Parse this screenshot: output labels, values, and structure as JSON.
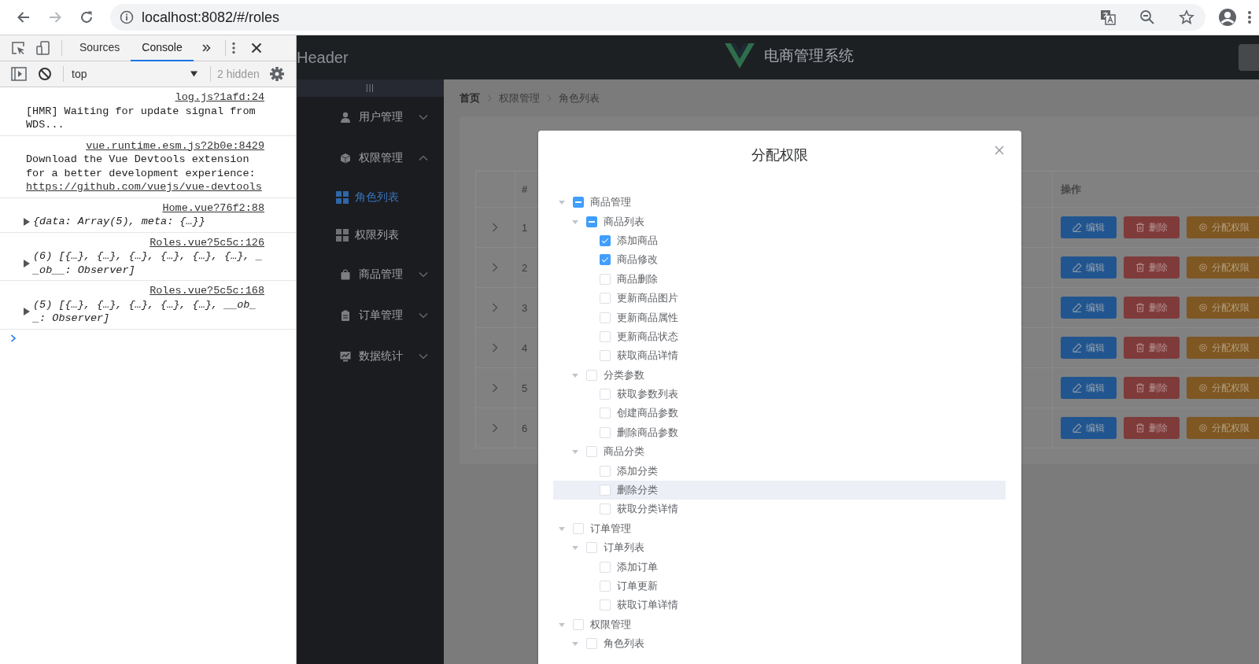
{
  "browser": {
    "url": "localhost:8082/#/roles"
  },
  "devtools": {
    "tabs": [
      {
        "label": "Sources",
        "selected": false
      },
      {
        "label": "Console",
        "selected": true
      }
    ],
    "context": "top",
    "hidden_count": "2 hidden",
    "messages": [
      {
        "kind": "text",
        "text": "[HMR] Waiting for update signal from WDS...",
        "source": "log.js?1afd:24"
      },
      {
        "kind": "text",
        "text": "Download the Vue Devtools extension for a better development experience:",
        "source": "vue.runtime.esm.js?2b0e:8429",
        "link": "https://github.com/vuejs/vue-devtools"
      },
      {
        "kind": "object",
        "text": "{data: Array(5), meta: {…}}",
        "source": "Home.vue?76f2:88",
        "expanded": false
      },
      {
        "kind": "object",
        "text": "(6) [{…}, {…}, {…}, {…}, {…}, {…}, __ob__: Observer]",
        "source": "Roles.vue?5c5c:126",
        "expanded": false
      },
      {
        "kind": "object",
        "text": "(5) [{…}, {…}, {…}, {…}, {…}, __ob__: Observer]",
        "source": "Roles.vue?5c5c:168",
        "expanded": false
      }
    ]
  },
  "header": {
    "title": "Header",
    "app_name": "电商管理系统"
  },
  "sidebar": {
    "toggle": "|||",
    "items": [
      {
        "label": "用户管理",
        "expanded": false
      },
      {
        "label": "权限管理",
        "expanded": true,
        "children": [
          {
            "label": "角色列表",
            "selected": true
          },
          {
            "label": "权限列表",
            "selected": false
          }
        ]
      },
      {
        "label": "商品管理",
        "expanded": false
      },
      {
        "label": "订单管理",
        "expanded": false
      },
      {
        "label": "数据统计",
        "expanded": false
      }
    ]
  },
  "breadcrumb": [
    "首页",
    "权限管理",
    "角色列表"
  ],
  "table": {
    "columns": [
      "#",
      "操作"
    ],
    "rows": [
      {
        "index": "1",
        "expanded": false,
        "actions": [
          {
            "kind": "edit",
            "label": "编辑"
          },
          {
            "kind": "delete",
            "label": "删除"
          },
          {
            "kind": "assign",
            "label": "分配权限"
          }
        ]
      },
      {
        "index": "2",
        "expanded": false,
        "actions": [
          {
            "kind": "edit",
            "label": "编辑"
          },
          {
            "kind": "delete",
            "label": "删除"
          },
          {
            "kind": "assign",
            "label": "分配权限"
          }
        ]
      },
      {
        "index": "3",
        "expanded": false,
        "actions": [
          {
            "kind": "edit",
            "label": "编辑"
          },
          {
            "kind": "delete",
            "label": "删除"
          },
          {
            "kind": "assign",
            "label": "分配权限"
          }
        ]
      },
      {
        "index": "4",
        "expanded": false,
        "actions": [
          {
            "kind": "edit",
            "label": "编辑"
          },
          {
            "kind": "delete",
            "label": "删除"
          },
          {
            "kind": "assign",
            "label": "分配权限"
          }
        ]
      },
      {
        "index": "5",
        "expanded": false,
        "actions": [
          {
            "kind": "edit",
            "label": "编辑"
          },
          {
            "kind": "delete",
            "label": "删除"
          },
          {
            "kind": "assign",
            "label": "分配权限"
          }
        ]
      },
      {
        "index": "6",
        "expanded": false,
        "actions": [
          {
            "kind": "edit",
            "label": "编辑"
          },
          {
            "kind": "delete",
            "label": "删除"
          },
          {
            "kind": "assign",
            "label": "分配权限"
          }
        ]
      }
    ]
  },
  "dialog": {
    "title": "分配权限",
    "tree": [
      {
        "label": "商品管理",
        "checked": false,
        "indeterminate": true,
        "hovered": false,
        "expanded": true,
        "children": [
          {
            "label": "商品列表",
            "checked": false,
            "indeterminate": true,
            "hovered": false,
            "expanded": true,
            "children": [
              {
                "label": "添加商品",
                "checked": true,
                "hovered": false
              },
              {
                "label": "商品修改",
                "checked": true,
                "hovered": false
              },
              {
                "label": "商品删除",
                "checked": false,
                "hovered": false
              },
              {
                "label": "更新商品图片",
                "checked": false,
                "hovered": false
              },
              {
                "label": "更新商品属性",
                "checked": false,
                "hovered": false
              },
              {
                "label": "更新商品状态",
                "checked": false,
                "hovered": false
              },
              {
                "label": "获取商品详情",
                "checked": false,
                "hovered": false
              }
            ]
          },
          {
            "label": "分类参数",
            "checked": false,
            "indeterminate": false,
            "hovered": false,
            "expanded": true,
            "children": [
              {
                "label": "获取参数列表",
                "checked": false,
                "hovered": false
              },
              {
                "label": "创建商品参数",
                "checked": false,
                "hovered": false
              },
              {
                "label": "删除商品参数",
                "checked": false,
                "hovered": false
              }
            ]
          },
          {
            "label": "商品分类",
            "checked": false,
            "indeterminate": false,
            "hovered": false,
            "expanded": true,
            "children": [
              {
                "label": "添加分类",
                "checked": false,
                "hovered": false
              },
              {
                "label": "删除分类",
                "checked": false,
                "hovered": true
              },
              {
                "label": "获取分类详情",
                "checked": false,
                "hovered": false
              }
            ]
          }
        ]
      },
      {
        "label": "订单管理",
        "checked": false,
        "indeterminate": false,
        "hovered": false,
        "expanded": true,
        "children": [
          {
            "label": "订单列表",
            "checked": false,
            "indeterminate": false,
            "hovered": false,
            "expanded": true,
            "children": [
              {
                "label": "添加订单",
                "checked": false,
                "hovered": false
              },
              {
                "label": "订单更新",
                "checked": false,
                "hovered": false
              },
              {
                "label": "获取订单详情",
                "checked": false,
                "hovered": false
              }
            ]
          }
        ]
      },
      {
        "label": "权限管理",
        "checked": false,
        "indeterminate": false,
        "hovered": false,
        "expanded": true,
        "children": [
          {
            "label": "角色列表",
            "checked": false,
            "indeterminate": false,
            "hovered": false,
            "expanded": true
          }
        ]
      }
    ]
  }
}
